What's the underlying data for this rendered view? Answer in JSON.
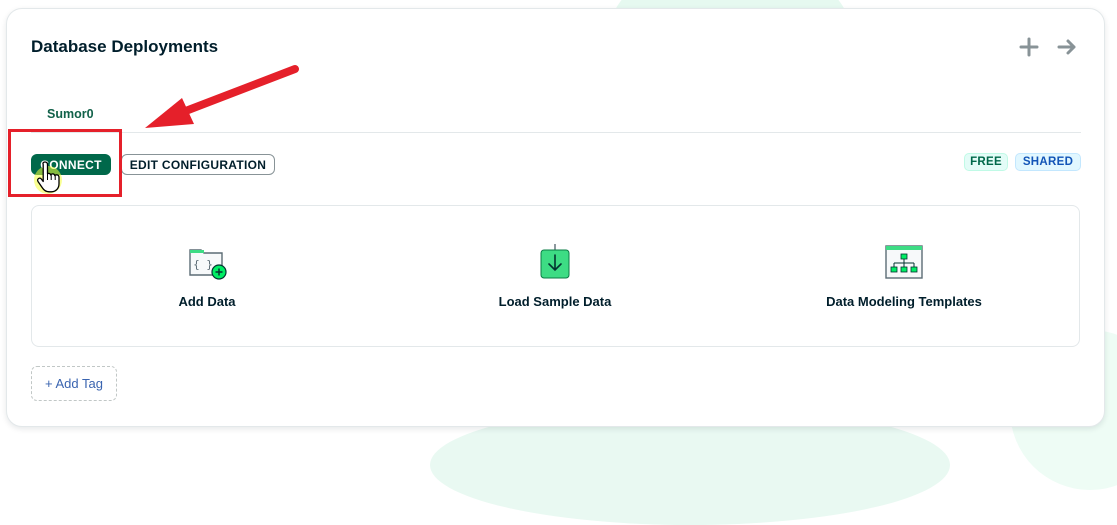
{
  "header": {
    "title": "Database Deployments"
  },
  "tabs": [
    {
      "label": "Sumor0",
      "active": true
    }
  ],
  "buttons": {
    "connect": "CONNECT",
    "edit_configuration": "EDIT CONFIGURATION"
  },
  "badges": {
    "tier": "FREE",
    "type": "SHARED"
  },
  "actions": [
    {
      "label": "Add Data",
      "icon": "folder-plus-icon"
    },
    {
      "label": "Load Sample Data",
      "icon": "download-icon"
    },
    {
      "label": "Data Modeling Templates",
      "icon": "hierarchy-icon"
    }
  ],
  "tags": {
    "add_label": "+ Add Tag"
  },
  "colors": {
    "brand_green": "#00684a",
    "highlight_red": "#e5202a",
    "free_badge_bg": "#e3fcf7",
    "shared_badge_bg": "#e1f7ff"
  },
  "icons": [
    "plus-icon",
    "arrow-right-icon",
    "pointer-hand-icon"
  ]
}
